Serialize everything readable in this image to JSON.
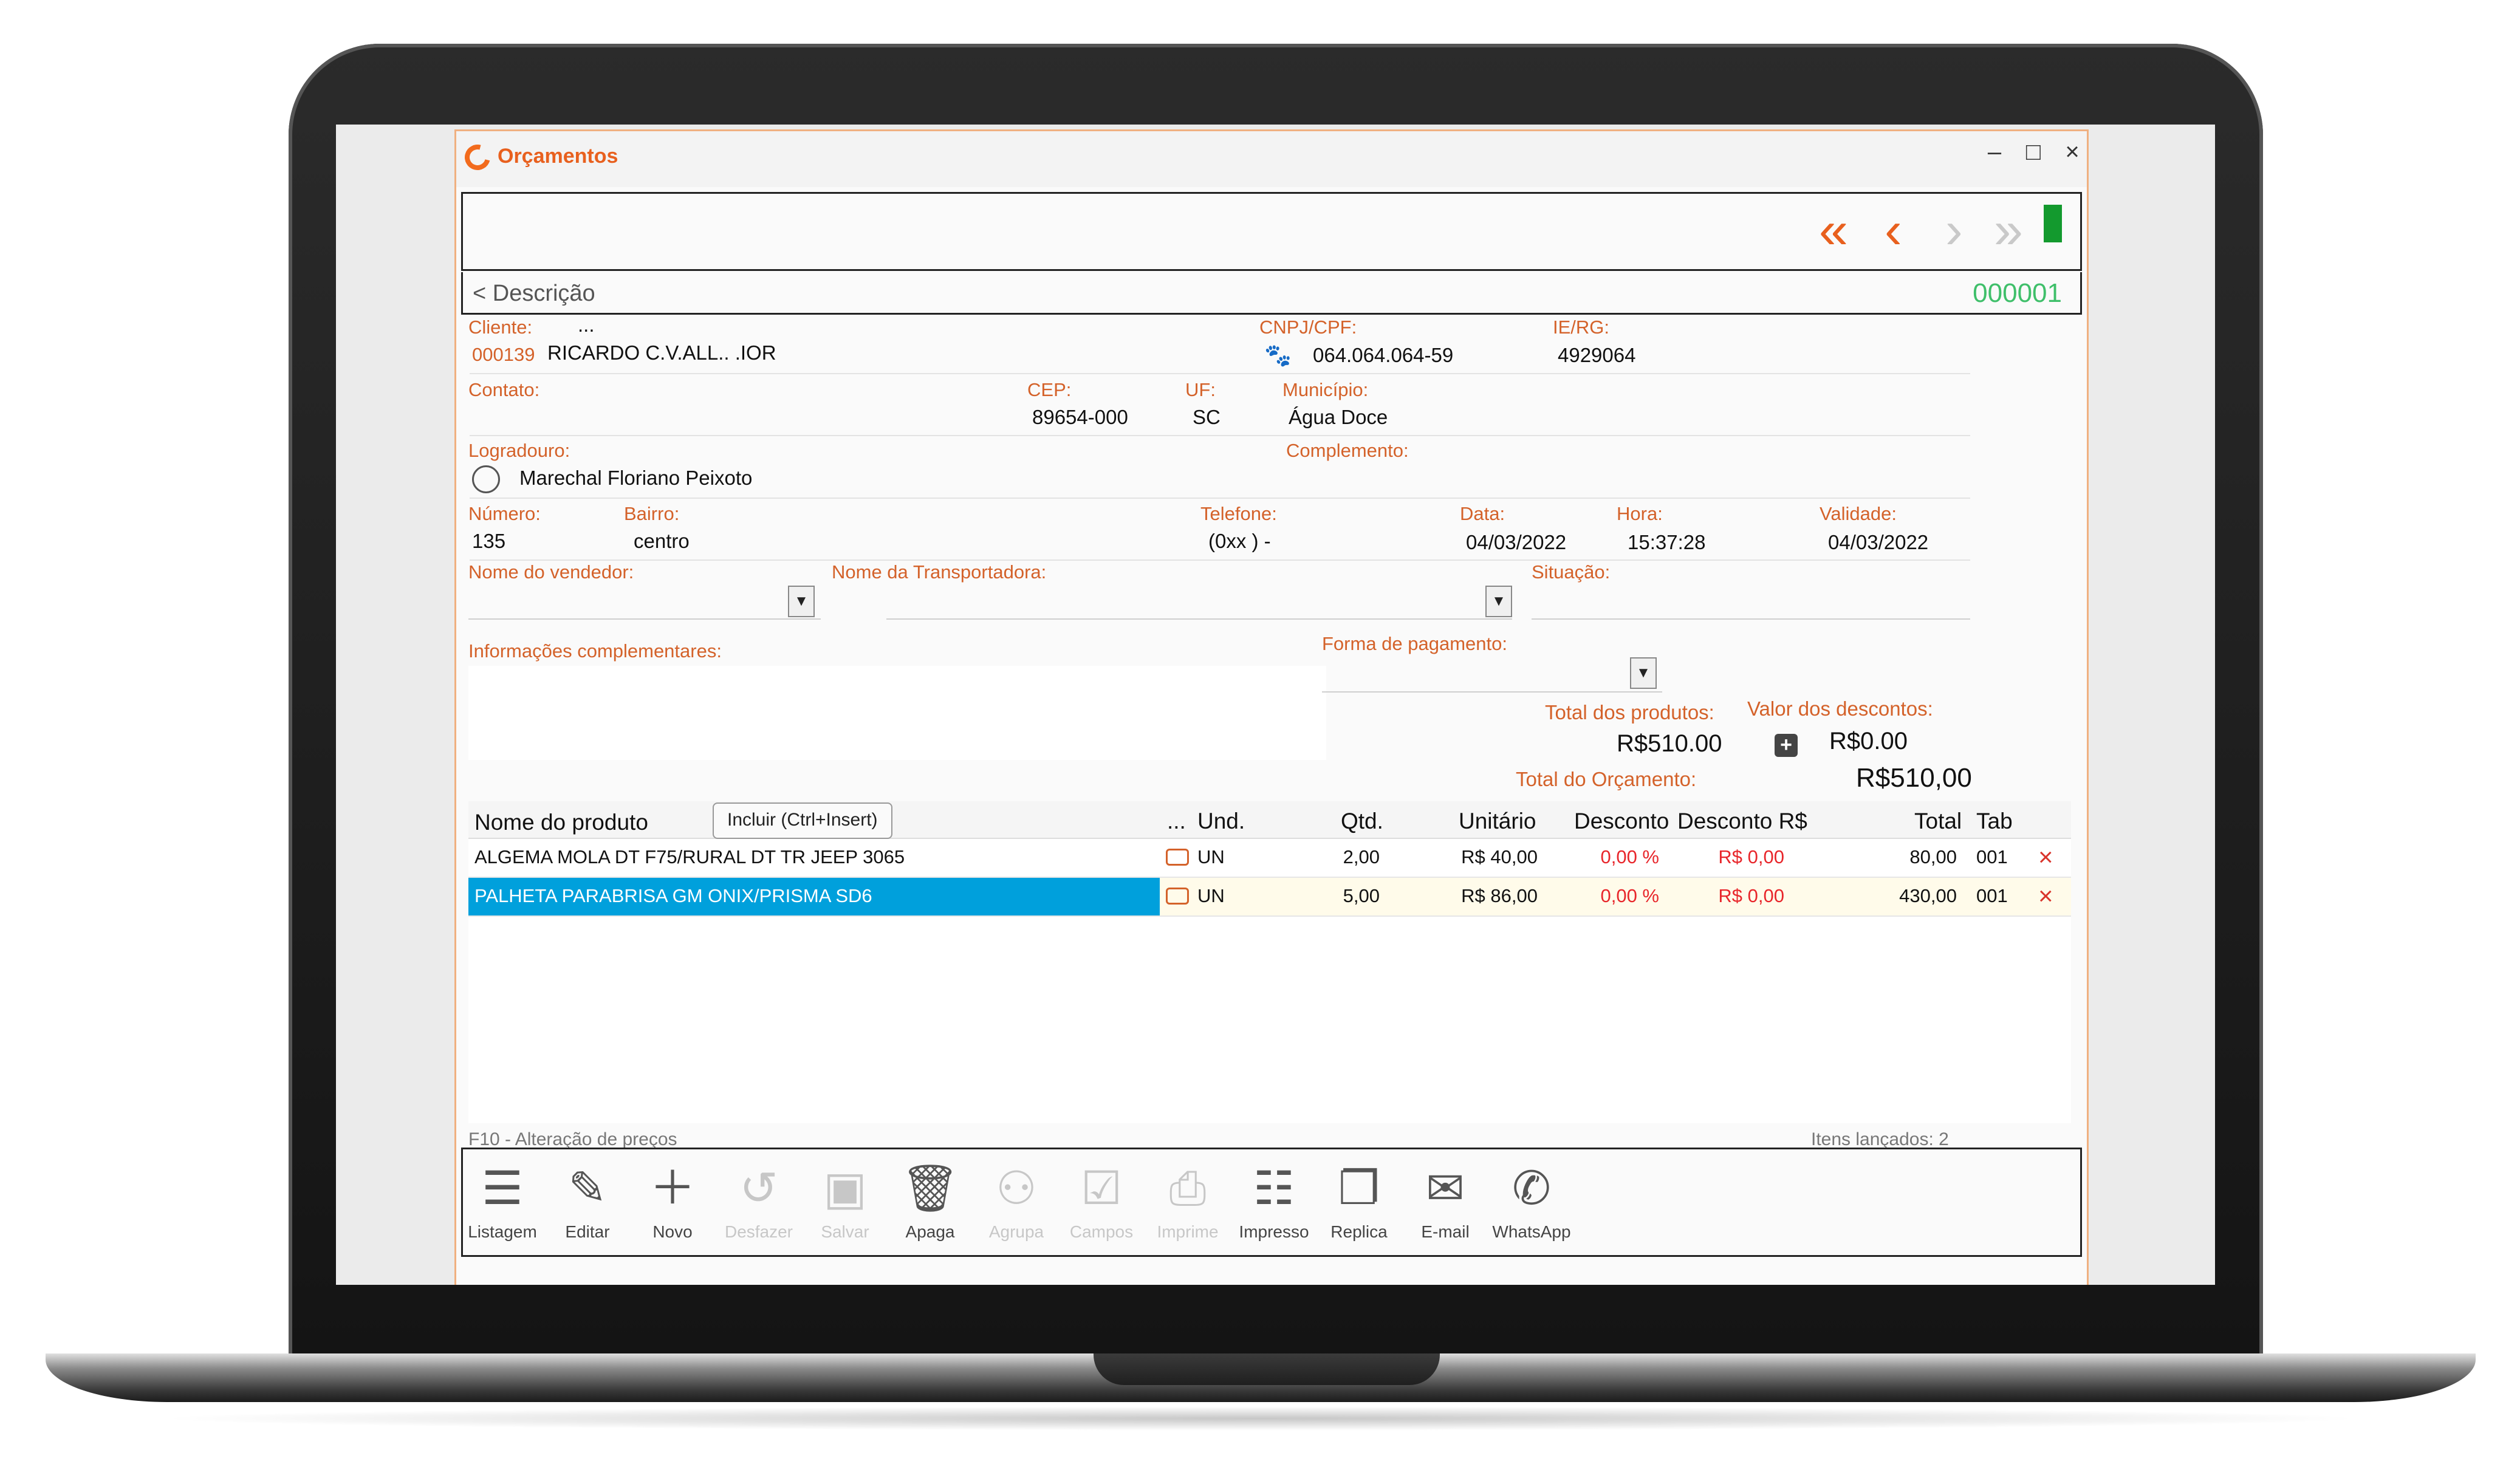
{
  "window": {
    "title": "Orçamentos",
    "minimize": "–",
    "maximize": "□",
    "close": "×"
  },
  "nav": {
    "first": "«",
    "prev": "‹",
    "next": "›",
    "last": "»"
  },
  "description": {
    "label": "< Descrição",
    "record_number": "000001"
  },
  "form": {
    "cliente_label": "Cliente:",
    "cliente_ellipsis": "...",
    "cliente_code": "000139",
    "cliente_name": "RICARDO C.V.ALL.. .IOR",
    "cnpj_label": "CNPJ/CPF:",
    "cnpj_value": "064.064.064-59",
    "ie_label": "IE/RG:",
    "ie_value": "4929064",
    "contato_label": "Contato:",
    "cep_label": "CEP:",
    "cep_value": "89654-000",
    "uf_label": "UF:",
    "uf_value": "SC",
    "municipio_label": "Município:",
    "municipio_value": "Água Doce",
    "logradouro_label": "Logradouro:",
    "logradouro_value": "Marechal Floriano Peixoto",
    "complemento_label": "Complemento:",
    "numero_label": "Número:",
    "numero_value": "135",
    "bairro_label": "Bairro:",
    "bairro_value": "centro",
    "telefone_label": "Telefone:",
    "telefone_value": "(0xx )  -",
    "data_label": "Data:",
    "data_value": "04/03/2022",
    "hora_label": "Hora:",
    "hora_value": "15:37:28",
    "validade_label": "Validade:",
    "validade_value": "04/03/2022",
    "vendedor_label": "Nome do vendedor:",
    "transportadora_label": "Nome da Transportadora:",
    "situacao_label": "Situação:",
    "info_label": "Informações complementares:",
    "pagamento_label": "Forma de pagamento:",
    "total_produtos_label": "Total dos produtos:",
    "total_produtos_value": "R$510.00",
    "descontos_label": "Valor dos descontos:",
    "descontos_value": "R$0.00",
    "total_orcamento_label": "Total do Orçamento:",
    "total_orcamento_value": "R$510,00"
  },
  "grid": {
    "headers": {
      "nome": "Nome do produto",
      "more": "...",
      "und": "Und.",
      "qtd": "Qtd.",
      "unitario": "Unitário",
      "desconto": "Desconto",
      "desconto_rs": "Desconto R$",
      "total": "Total",
      "tab": "Tab"
    },
    "include_button": "Incluir (Ctrl+Insert)",
    "rows": [
      {
        "nome": "ALGEMA MOLA DT F75/RURAL DT TR JEEP 3065",
        "und": "UN",
        "qtd": "2,00",
        "unitario": "R$ 40,00",
        "desconto": "0,00 %",
        "desconto_rs": "R$ 0,00",
        "total": "80,00",
        "tab": "001"
      },
      {
        "nome": "PALHETA PARABRISA GM ONIX/PRISMA SD6",
        "und": "UN",
        "qtd": "5,00",
        "unitario": "R$ 86,00",
        "desconto": "0,00 %",
        "desconto_rs": "R$ 0,00",
        "total": "430,00",
        "tab": "001"
      }
    ]
  },
  "status": {
    "left": "F10 - Alteração de preços",
    "right": "Itens lançados: 2"
  },
  "toolbar": {
    "listagem": "Listagem",
    "editar": "Editar",
    "novo": "Novo",
    "desfazer": "Desfazer",
    "salvar": "Salvar",
    "apaga": "Apaga",
    "agrupa": "Agrupa",
    "campos": "Campos",
    "imprime": "Imprime",
    "impresso": "Impresso",
    "replica": "Replica",
    "email": "E-mail",
    "whatsapp": "WhatsApp"
  },
  "colors": {
    "accent": "#e8601e",
    "label": "#d4622a",
    "selection": "#00a0dc",
    "record_number": "#3fbf6a",
    "discount_red": "#e8262b"
  }
}
